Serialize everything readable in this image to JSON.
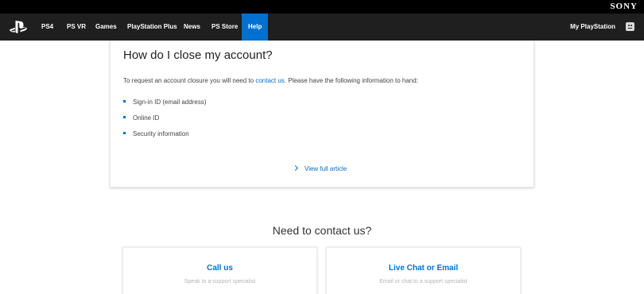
{
  "brand": {
    "sony": "SONY"
  },
  "nav": {
    "items": [
      {
        "label": "PS4"
      },
      {
        "label": "PS VR"
      },
      {
        "label": "Games"
      },
      {
        "label": "PlayStation Plus"
      },
      {
        "label": "News"
      },
      {
        "label": "PS Store"
      },
      {
        "label": "Help",
        "active": true
      }
    ],
    "account_label": "My PlayStation",
    "accent": "#0070d1"
  },
  "article": {
    "title": "How do I close my account?",
    "intro_before": "To request an account closure you will need to ",
    "intro_link": "contact us",
    "intro_after": ". Please have the following information to hand:",
    "bullets": [
      "Sign-in ID (email address)",
      "Online ID",
      "Security information"
    ],
    "view_full": "View full article"
  },
  "contact": {
    "heading": "Need to contact us?",
    "options": [
      {
        "title": "Call us",
        "subtitle": "Speak to a support specialist"
      },
      {
        "title": "Live Chat or Email",
        "subtitle": "Email or chat to a support specialist"
      }
    ]
  }
}
